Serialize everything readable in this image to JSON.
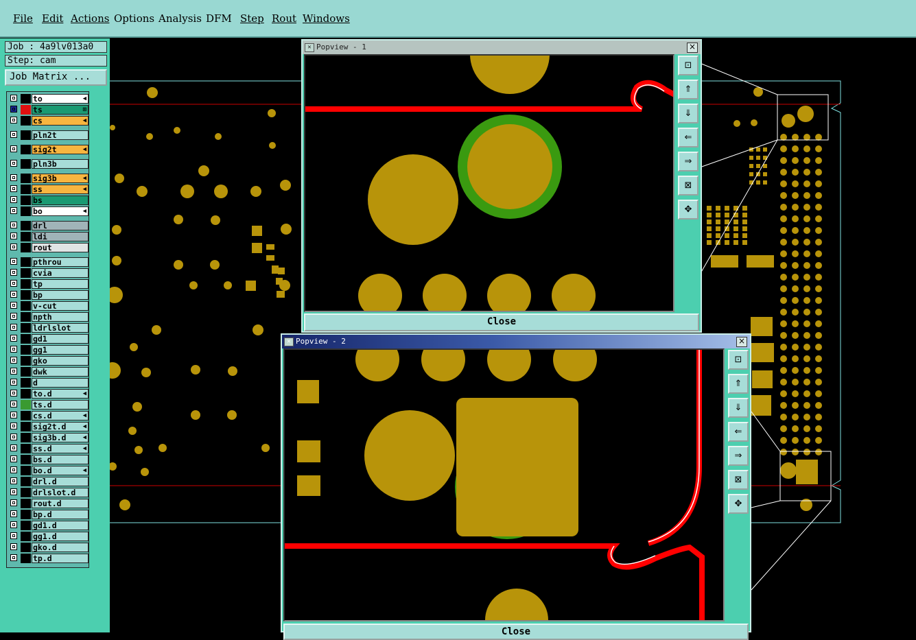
{
  "menu": {
    "items": [
      {
        "label": "File"
      },
      {
        "label": "Edit"
      },
      {
        "label": "Actions"
      },
      {
        "label": "Options"
      },
      {
        "label": "Analysis"
      },
      {
        "label": "DFM"
      },
      {
        "label": "Step"
      },
      {
        "label": "Rout"
      },
      {
        "label": "Windows"
      }
    ]
  },
  "job": {
    "job_text": "Job : 4a9lv013a0",
    "step_text": "Step: cam",
    "matrix_label": "Job Matrix ..."
  },
  "layers": [
    {
      "name": "to",
      "color": "#ffffff",
      "arrow": "◀"
    },
    {
      "name": "ts",
      "color": "#1a9a72",
      "arrow": "⊞",
      "swatch": "#e01010",
      "active": true
    },
    {
      "name": "cs",
      "color": "#f7b540",
      "arrow": "◀"
    },
    {
      "name": "pln2t",
      "color": "#a7ddd8",
      "arrow": ""
    },
    {
      "name": "sig2t",
      "color": "#f7b540",
      "arrow": "◀"
    },
    {
      "name": "pln3b",
      "color": "#a7ddd8",
      "arrow": ""
    },
    {
      "name": "sig3b",
      "color": "#f7b540",
      "arrow": "◀"
    },
    {
      "name": "ss",
      "color": "#f7b540",
      "arrow": "◀"
    },
    {
      "name": "bs",
      "color": "#1a9a72",
      "arrow": ""
    },
    {
      "name": "bo",
      "color": "#ffffff",
      "arrow": "◀"
    },
    {
      "name": "drl",
      "color": "#a0b4b8",
      "arrow": ""
    },
    {
      "name": "ldi",
      "color": "#a0b4b8",
      "arrow": ""
    },
    {
      "name": "rout",
      "color": "#e0e4e4",
      "arrow": ""
    },
    {
      "name": "pthrou",
      "color": "#a7ddd8",
      "arrow": ""
    },
    {
      "name": "cvia",
      "color": "#a7ddd8",
      "arrow": ""
    },
    {
      "name": "tp",
      "color": "#a7ddd8",
      "arrow": ""
    },
    {
      "name": "bp",
      "color": "#a7ddd8",
      "arrow": ""
    },
    {
      "name": "v-cut",
      "color": "#a7ddd8",
      "arrow": ""
    },
    {
      "name": "npth",
      "color": "#a7ddd8",
      "arrow": ""
    },
    {
      "name": "ldrlslot",
      "color": "#a7ddd8",
      "arrow": ""
    },
    {
      "name": "gd1",
      "color": "#a7ddd8",
      "arrow": ""
    },
    {
      "name": "gg1",
      "color": "#a7ddd8",
      "arrow": ""
    },
    {
      "name": "gko",
      "color": "#a7ddd8",
      "arrow": ""
    },
    {
      "name": "dwk",
      "color": "#a7ddd8",
      "arrow": ""
    },
    {
      "name": "d",
      "color": "#a7ddd8",
      "arrow": ""
    },
    {
      "name": "to.d",
      "color": "#a7ddd8",
      "arrow": "◀"
    },
    {
      "name": "ts.d",
      "color": "#a7ddd8",
      "arrow": "",
      "swatch": "#3a9a30"
    },
    {
      "name": "cs.d",
      "color": "#a7ddd8",
      "arrow": "◀"
    },
    {
      "name": "sig2t.d",
      "color": "#a7ddd8",
      "arrow": "◀"
    },
    {
      "name": "sig3b.d",
      "color": "#a7ddd8",
      "arrow": "◀"
    },
    {
      "name": "ss.d",
      "color": "#a7ddd8",
      "arrow": "◀"
    },
    {
      "name": "bs.d",
      "color": "#a7ddd8",
      "arrow": ""
    },
    {
      "name": "bo.d",
      "color": "#a7ddd8",
      "arrow": "◀"
    },
    {
      "name": "drl.d",
      "color": "#a7ddd8",
      "arrow": ""
    },
    {
      "name": "drlslot.d",
      "color": "#a7ddd8",
      "arrow": ""
    },
    {
      "name": "rout.d",
      "color": "#a7ddd8",
      "arrow": ""
    },
    {
      "name": "bp.d",
      "color": "#a7ddd8",
      "arrow": ""
    },
    {
      "name": "gd1.d",
      "color": "#a7ddd8",
      "arrow": ""
    },
    {
      "name": "gg1.d",
      "color": "#a7ddd8",
      "arrow": ""
    },
    {
      "name": "gko.d",
      "color": "#a7ddd8",
      "arrow": ""
    },
    {
      "name": "tp.d",
      "color": "#a7ddd8",
      "arrow": ""
    }
  ],
  "popview1": {
    "title": "Popview - 1",
    "close_label": "Close"
  },
  "popview2": {
    "title": "Popview - 2",
    "close_label": "Close"
  },
  "toolbar_icons": [
    "zoom-window-icon",
    "zoom-in-icon",
    "zoom-out-icon",
    "pan-left-icon",
    "pan-right-icon",
    "fit-home-icon",
    "pan-center-icon"
  ],
  "colors": {
    "pad": "#b8940a",
    "trace": "#ff0000",
    "mask": "#3a9a10",
    "outline": "#7fe0e0",
    "panel": "#4ccfaf",
    "menubar": "#99d8d2"
  }
}
